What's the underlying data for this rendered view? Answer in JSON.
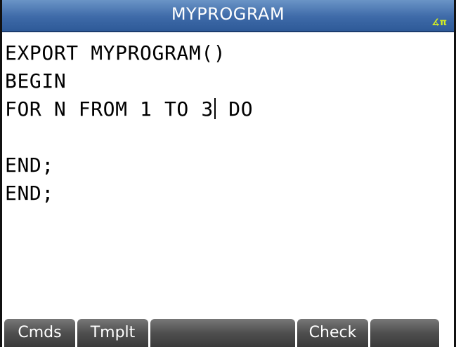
{
  "window": {
    "title": "MYPROGRAM",
    "angle_mode_indicator": "∡π",
    "angle_mode_color": "#d8f020"
  },
  "editor": {
    "lines": [
      "EXPORT MYPROGRAM()",
      "BEGIN",
      "FOR N FROM 1 TO 3",
      "",
      "END;",
      "END;"
    ],
    "cursor_line_suffix": " DO",
    "cursor_line_index": 2
  },
  "menu": {
    "items": [
      {
        "label": "Cmds"
      },
      {
        "label": "Tmplt"
      },
      {
        "label": ""
      },
      {
        "label": "Check"
      },
      {
        "label": ""
      }
    ]
  },
  "colors": {
    "title_bar": "#3e6aa8",
    "softkey": "#4f4f4f"
  }
}
